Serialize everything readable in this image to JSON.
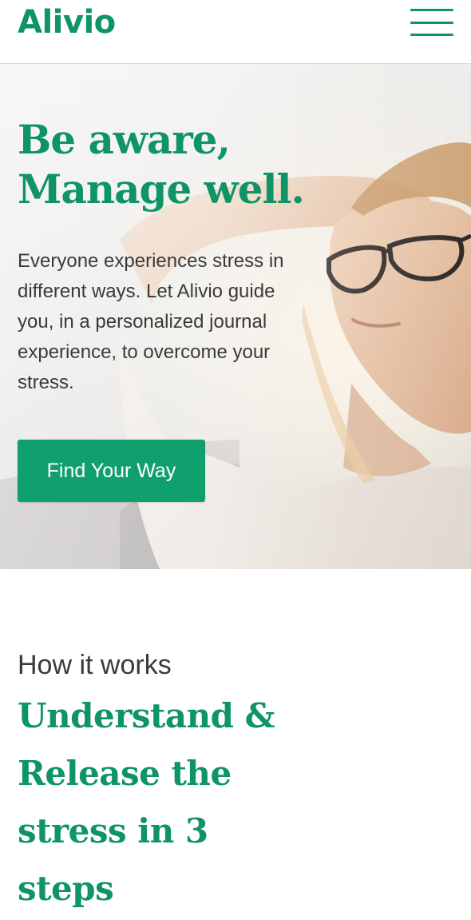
{
  "brand": {
    "name": "Alivio",
    "accent_color": "#0e9466"
  },
  "nav": {
    "menu_icon": "hamburger-menu-icon"
  },
  "hero": {
    "title_line1": "Be aware,",
    "title_line2": "Manage well.",
    "body": "Everyone experiences stress in different ways. Let Alivio guide you, in a personalized journal experience, to overcome your stress.",
    "cta_label": "Find Your Way",
    "image_subject": "woman-relaxing-with-glasses-photo"
  },
  "how_it_works": {
    "kicker": "How it works",
    "title": "Understand & Release the stress in 3 steps"
  }
}
